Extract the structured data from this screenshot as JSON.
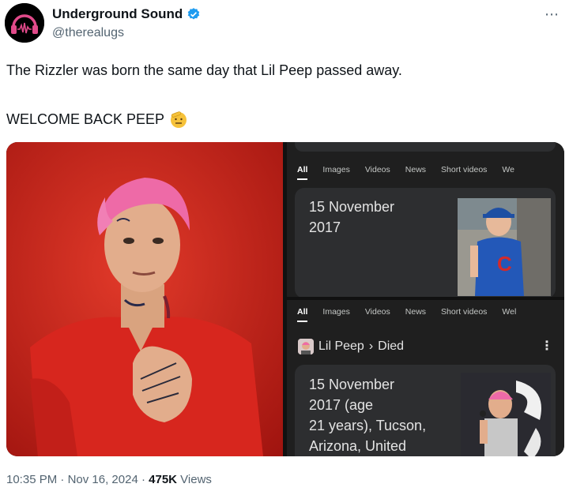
{
  "author": {
    "display_name": "Underground Sound",
    "handle": "@therealugs",
    "verified": true
  },
  "more_icon": "⋯",
  "tweet": {
    "line1": "The Rizzler was born the same day that Lil Peep passed away.",
    "line2": "WELCOME BACK PEEP",
    "emoji": "saluting-face-emoji"
  },
  "search_top": {
    "tabs": [
      "All",
      "Images",
      "Videos",
      "News",
      "Short videos",
      "We"
    ],
    "result_line1": "15 November",
    "result_line2": "2017"
  },
  "search_bottom": {
    "tabs": [
      "All",
      "Images",
      "Videos",
      "News",
      "Short videos",
      "Wel"
    ],
    "entity_name": "Lil Peep",
    "entity_separator": "›",
    "entity_attribute": "Died",
    "result_lines": [
      "15 November",
      "2017 (age",
      "21 years), Tucson,",
      "Arizona, United"
    ]
  },
  "meta": {
    "time": "10:35 PM",
    "date": "Nov 16, 2024",
    "separator": "·",
    "views_count": "475K",
    "views_label": "Views"
  },
  "colors": {
    "verified_blue": "#1d9bf0",
    "search_bg": "#1f1f1f",
    "card_bg": "#2d2e30",
    "photo_red": "#c8231c"
  }
}
